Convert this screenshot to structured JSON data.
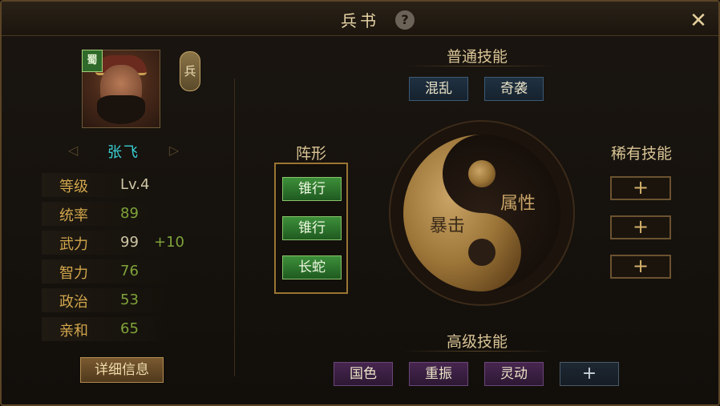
{
  "window": {
    "title": "兵书",
    "help_label": "?",
    "close_label": "✕"
  },
  "general": {
    "faction_badge": "蜀",
    "troop_tag": "兵",
    "name": "张飞",
    "prev_arrow": "◁",
    "next_arrow": "▷",
    "stats": [
      {
        "label": "等级",
        "value": "Lv.4",
        "bonus": ""
      },
      {
        "label": "统率",
        "value": "89",
        "bonus": ""
      },
      {
        "label": "武力",
        "value": "99",
        "bonus": "+10"
      },
      {
        "label": "智力",
        "value": "76",
        "bonus": ""
      },
      {
        "label": "政治",
        "value": "53",
        "bonus": ""
      },
      {
        "label": "亲和",
        "value": "65",
        "bonus": ""
      }
    ],
    "detail_button": "详细信息"
  },
  "normal_skills": {
    "title": "普通技能",
    "items": [
      "混乱",
      "奇袭"
    ]
  },
  "formation": {
    "title": "阵形",
    "items": [
      "锥行",
      "锥行",
      "长蛇"
    ]
  },
  "taiji": {
    "left_label": "暴击",
    "right_label": "属性"
  },
  "rare_skills": {
    "title": "稀有技能",
    "slots": [
      "+",
      "+",
      "+"
    ]
  },
  "advanced_skills": {
    "title": "高级技能",
    "items": [
      "国色",
      "重振",
      "灵动"
    ],
    "add_label": "+"
  },
  "colors": {
    "accent": "#d2a64c",
    "name": "#3ad2d6",
    "green_value": "#7fa33a",
    "border": "#5a4426"
  }
}
